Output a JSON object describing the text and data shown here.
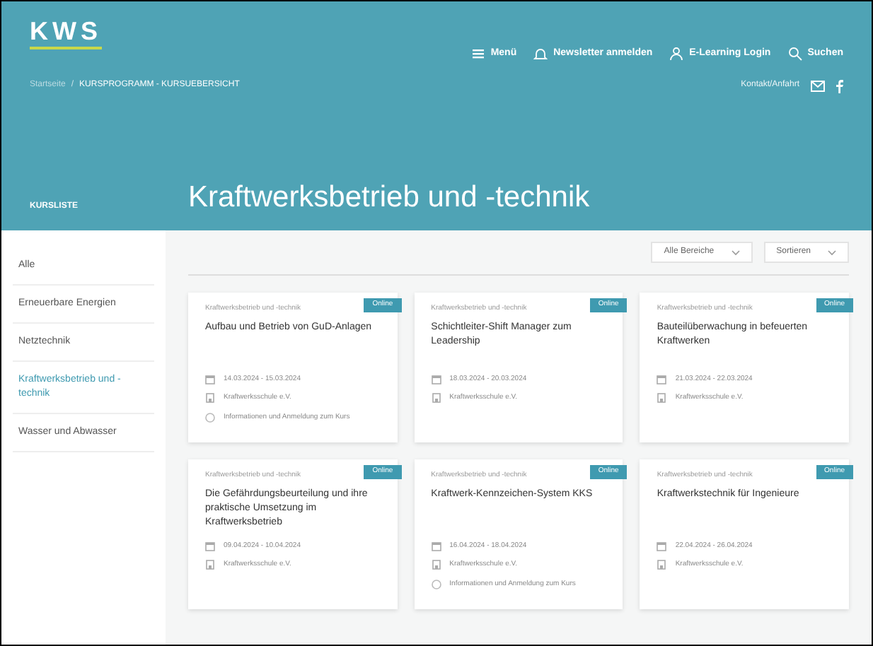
{
  "header": {
    "logo": "KWS",
    "nav": [
      {
        "kind": "menu",
        "label": "Menü"
      },
      {
        "kind": "bell",
        "label": "Newsletter anmelden"
      },
      {
        "kind": "user",
        "label": "E-Learning Login"
      },
      {
        "kind": "search",
        "label": "Suchen"
      }
    ],
    "breadcrumb": [
      "Startseite",
      "KURSPROGRAMM - KURSUEBERSICHT"
    ],
    "breadcrumb_separator": "/",
    "contact": "Kontakt/Anfahrt"
  },
  "section_label": "KURSLISTE",
  "title": "Kraftwerksbetrieb und -technik",
  "sidebar": {
    "items": [
      {
        "label": "Alle",
        "selected": false
      },
      {
        "label": "Erneuerbare Energien",
        "selected": false
      },
      {
        "label": "Netztechnik",
        "selected": false
      },
      {
        "label": "Kraftwerksbetrieb und -technik",
        "selected": true
      },
      {
        "label": "Wasser und Abwasser",
        "selected": false
      }
    ]
  },
  "filters": [
    {
      "value": "Alle Bereiche"
    },
    {
      "value": "Sortieren"
    }
  ],
  "cards": [
    {
      "category": "Kraftwerksbetrieb und -technik",
      "badge": "Online",
      "title": "Aufbau und Betrieb von GuD-Anlagen",
      "date": "14.03.2024 - 15.03.2024",
      "location": "Kraftwerksschule e.V.",
      "note": "Informationen und Anmeldung zum Kurs"
    },
    {
      "category": "Kraftwerksbetrieb und -technik",
      "badge": "Online",
      "title": "Schichtleiter-Shift Manager zum Leadership",
      "date": "18.03.2024 - 20.03.2024",
      "location": "Kraftwerksschule e.V."
    },
    {
      "category": "Kraftwerksbetrieb und -technik",
      "badge": "Online",
      "title": "Bauteilüberwachung in befeuerten Kraftwerken",
      "date": "21.03.2024 - 22.03.2024",
      "location": "Kraftwerksschule e.V."
    },
    {
      "category": "Kraftwerksbetrieb und -technik",
      "badge": "Online",
      "title": "Die Gefährdungsbeurteilung und ihre praktische Umsetzung im Kraftwerksbetrieb",
      "date": "09.04.2024 - 10.04.2024",
      "location": "Kraftwerksschule e.V."
    },
    {
      "category": "Kraftwerksbetrieb und -technik",
      "badge": "Online",
      "title": "Kraftwerk-Kennzeichen-System KKS",
      "date": "16.04.2024 - 18.04.2024",
      "location": "Kraftwerksschule e.V.",
      "note": "Informationen und Anmeldung zum Kurs"
    },
    {
      "category": "Kraftwerksbetrieb und -technik",
      "badge": "Online",
      "title": "Kraftwerkstechnik für Ingenieure",
      "date": "22.04.2024 - 26.04.2024",
      "location": "Kraftwerksschule e.V."
    }
  ]
}
